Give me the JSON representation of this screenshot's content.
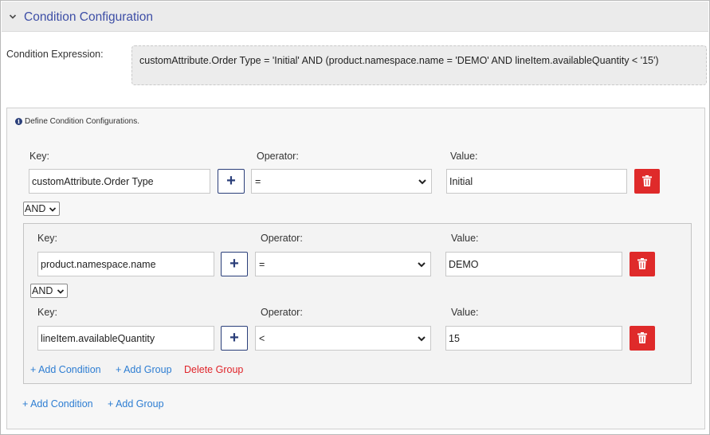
{
  "header": {
    "title": "Condition Configuration",
    "chevron_icon": "chevron-down-icon"
  },
  "expression": {
    "label": "Condition Expression:",
    "value": "customAttribute.Order Type = 'Initial' AND (product.namespace.name = 'DEMO' AND lineItem.availableQuantity < '15')"
  },
  "panel": {
    "info_icon": "info-icon",
    "info_text": "Define Condition Configurations."
  },
  "labels": {
    "key": "Key:",
    "operator": "Operator:",
    "value": "Value:",
    "plus": "+"
  },
  "root_condition": {
    "key": "customAttribute.Order Type",
    "operator": "=",
    "value": "Initial"
  },
  "root_logic": "AND",
  "group": {
    "conditions": [
      {
        "key": "product.namespace.name",
        "operator": "=",
        "value": "DEMO"
      },
      {
        "key": "lineItem.availableQuantity",
        "operator": "<",
        "value": "15"
      }
    ],
    "logic": "AND",
    "add_condition": "+ Add Condition",
    "add_group": "+ Add Group",
    "delete_group": "Delete Group"
  },
  "root_actions": {
    "add_condition": "+ Add Condition",
    "add_group": "+ Add Group"
  },
  "colors": {
    "title": "#3d4ea6",
    "link": "#2d7dd2",
    "danger": "#df2a2a",
    "primary": "#2b3f7a"
  }
}
